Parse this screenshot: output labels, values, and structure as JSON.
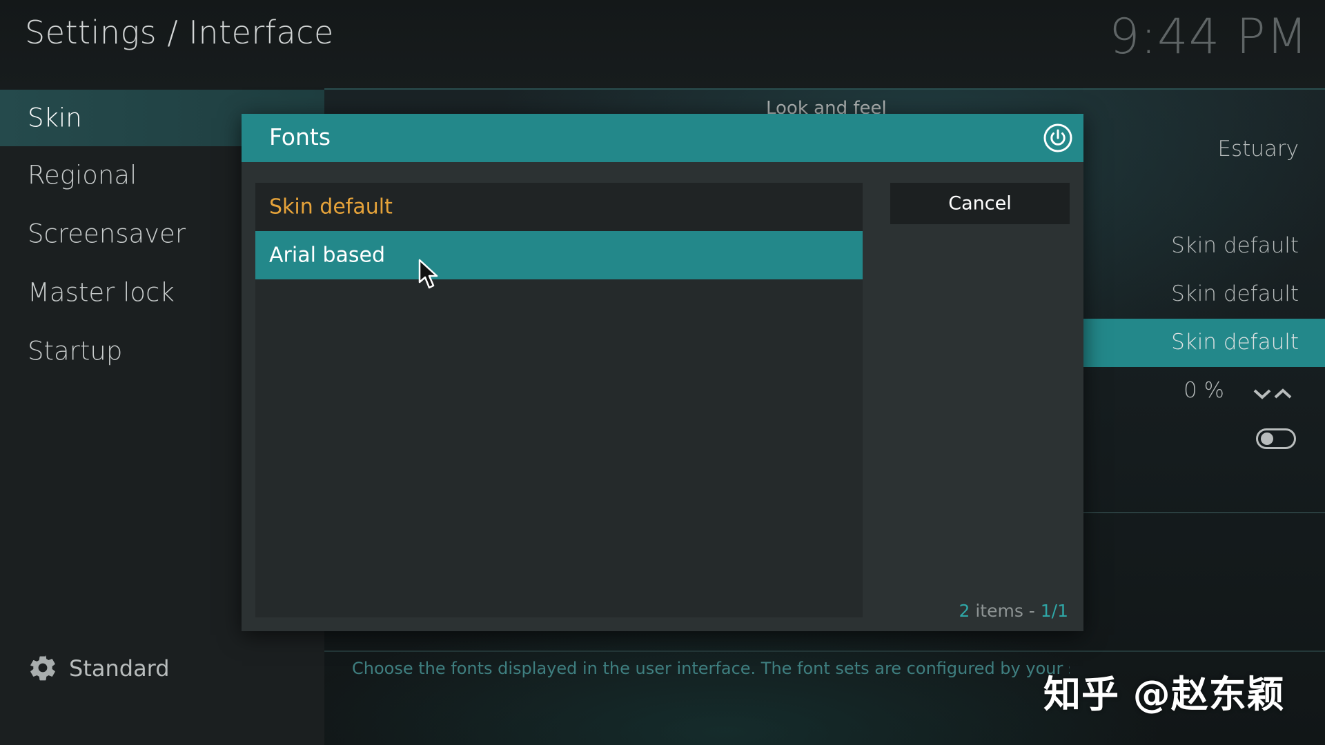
{
  "header": {
    "breadcrumb": "Settings / Interface",
    "clock": "9:44 PM"
  },
  "sidebar": {
    "items": [
      {
        "label": "Skin",
        "active": true
      },
      {
        "label": "Regional"
      },
      {
        "label": "Screensaver"
      },
      {
        "label": "Master lock"
      },
      {
        "label": "Startup"
      }
    ],
    "settings_level": "Standard",
    "settings_level_icon": "gear-icon"
  },
  "main": {
    "section_title": "Look and feel",
    "values": [
      "Estuary",
      "Skin default",
      "Skin default",
      "Skin default",
      "0 %"
    ],
    "zoom_spinner_icons": [
      "chevron-down-icon",
      "chevron-up-icon"
    ],
    "toggle_on": false,
    "description": "Choose the fonts displayed in the user interface. The font sets are configured by your skin."
  },
  "dialog": {
    "title": "Fonts",
    "close_icon": "power-icon",
    "options": [
      {
        "label": "Skin default",
        "current": true
      },
      {
        "label": "Arial based",
        "focused": true
      }
    ],
    "cancel_label": "Cancel",
    "item_count": "2",
    "item_count_label": " items - ",
    "page": "1/1"
  },
  "watermark": "知乎 @赵东颖",
  "colors": {
    "accent": "#23888a",
    "selected_text": "#e6a33a",
    "background": "#161b1c"
  }
}
